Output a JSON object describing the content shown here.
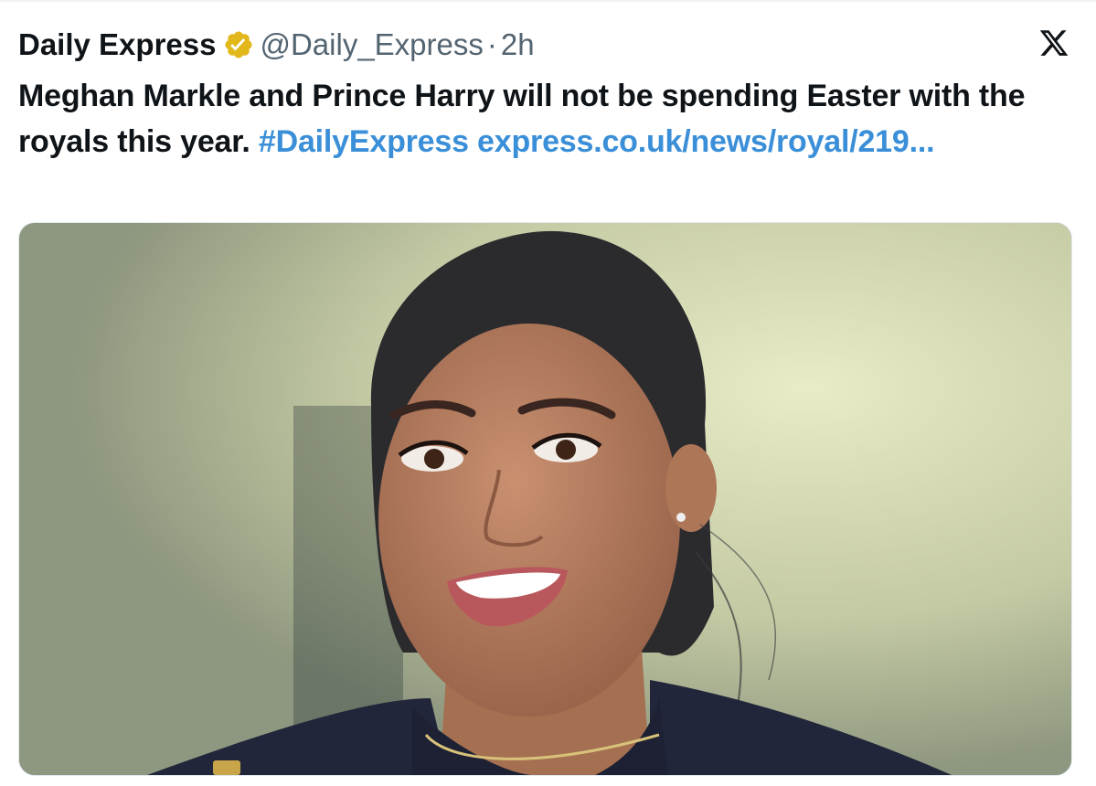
{
  "tweet": {
    "display_name": "Daily Express",
    "verified_icon": "verified-gold-badge-icon",
    "handle": "@Daily_Express",
    "separator": "·",
    "time": "2h",
    "platform_logo": "x-logo-icon",
    "text": "Meghan Markle and Prince Harry will not be spending Easter with the royals this year.",
    "hashtag": "#DailyExpress",
    "link": "express.co.uk/news/royal/219...",
    "media": {
      "alt": "photo"
    }
  },
  "colors": {
    "text": "#0f1419",
    "secondary": "#536471",
    "link": "#3a8fd8",
    "verified_gold": "#e2b719"
  }
}
